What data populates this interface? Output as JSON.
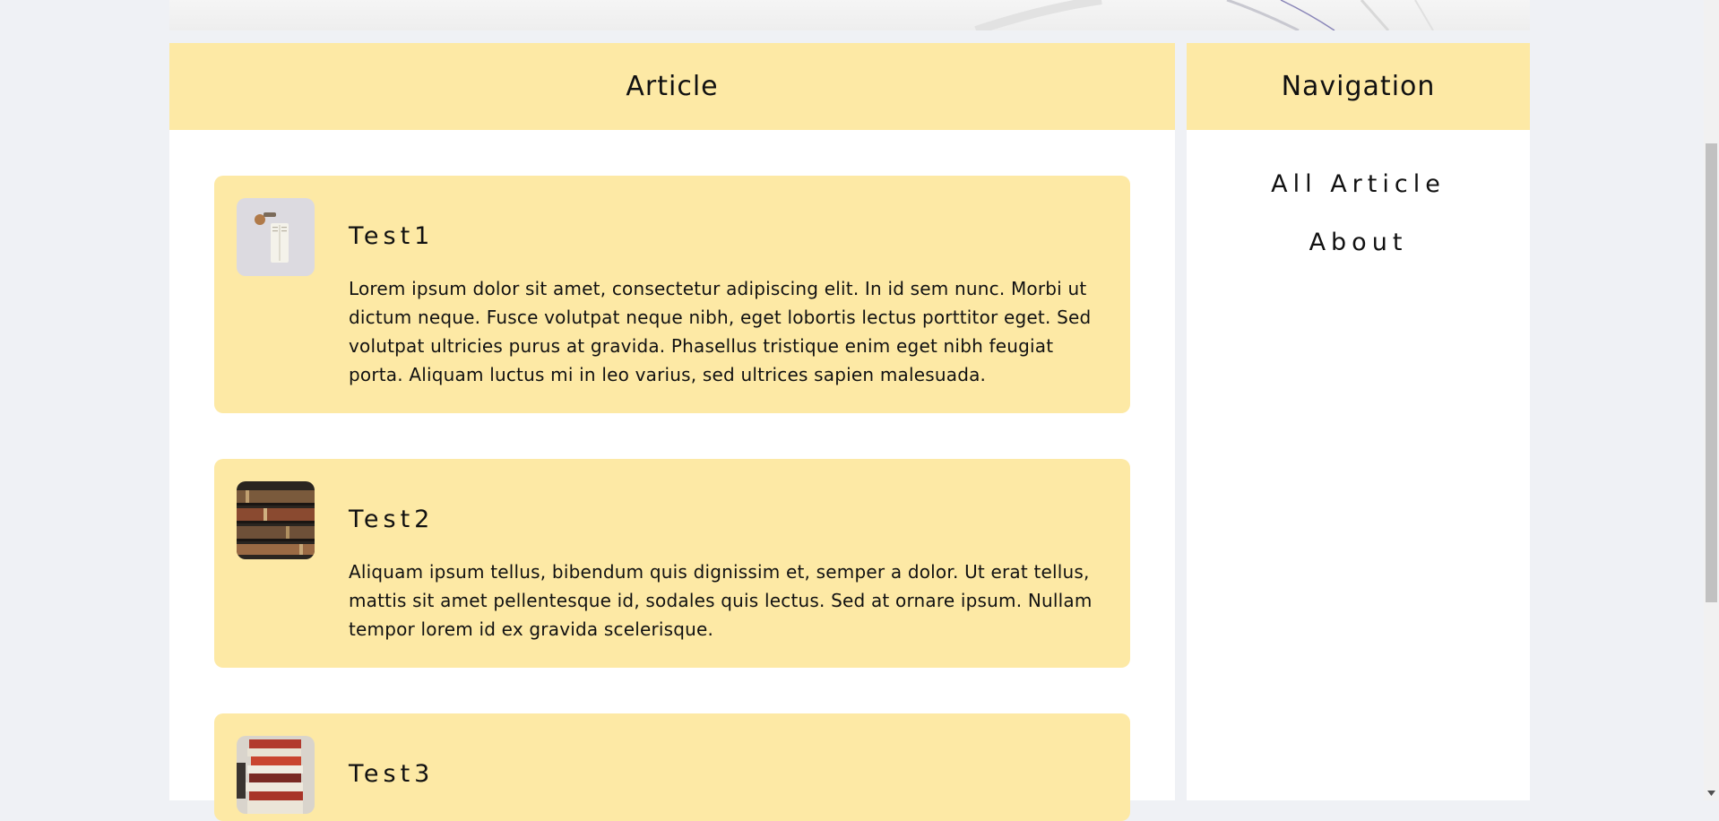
{
  "article_panel": {
    "title": "Article"
  },
  "nav_panel": {
    "title": "Navigation",
    "items": [
      {
        "label": "All Article"
      },
      {
        "label": "About"
      }
    ]
  },
  "cards": [
    {
      "title": "Test1",
      "thumbnail": "book-on-desk-image",
      "body": "Lorem ipsum dolor sit amet, consectetur adipiscing elit. In id sem nunc. Morbi ut dictum neque. Fusce volutpat neque nibh, eget lobortis lectus porttitor eget. Sed volutpat ultricies purus at gravida. Phasellus tristique enim eget nibh feugiat porta. Aliquam luctus mi in leo varius, sed ultrices sapien malesuada."
    },
    {
      "title": "Test2",
      "thumbnail": "library-shelves-image",
      "body": "Aliquam ipsum tellus, bibendum quis dignissim et, semper a dolor. Ut erat tellus, mattis sit amet pellentesque id, sodales quis lectus. Sed at ornare ipsum. Nullam tempor lorem id ex gravida scelerisque."
    },
    {
      "title": "Test3",
      "thumbnail": "book-stack-image",
      "body": ""
    }
  ],
  "colors": {
    "page_background": "#eff1f5",
    "panel_background": "#ffffff",
    "accent_yellow": "#fde9a5",
    "text": "#111111"
  }
}
